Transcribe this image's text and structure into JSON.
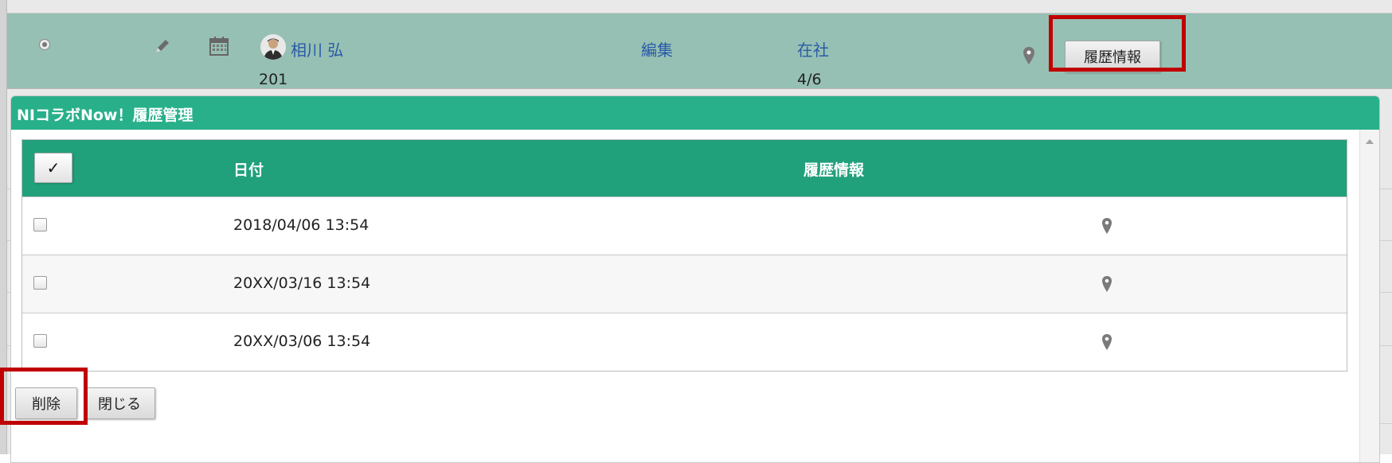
{
  "row": {
    "user_name": "相川 弘",
    "user_number": "201",
    "edit_label": "編集",
    "status": "在社",
    "ratio": "4/6",
    "history_button_label": "履歴情報",
    "icons": [
      "radio-icon",
      "pencil-icon",
      "calendar-icon",
      "avatar",
      "map-pin-icon"
    ]
  },
  "dialog": {
    "title": "NIコラボNow！履歴管理",
    "table": {
      "select_all_label": "✓",
      "columns": [
        "日付",
        "履歴情報"
      ],
      "rows": [
        {
          "date": "2018/04/06 13:54"
        },
        {
          "date": "20XX/03/16 13:54"
        },
        {
          "date": "20XX/03/06 13:54"
        }
      ]
    },
    "delete_label": "削除",
    "close_label": "閉じる"
  },
  "colors": {
    "header_green": "#28b08a",
    "table_header_green": "#21a07c",
    "selected_row": "#96c0b3",
    "link_blue": "#2a5aa8",
    "highlight_red": "#c00000"
  }
}
